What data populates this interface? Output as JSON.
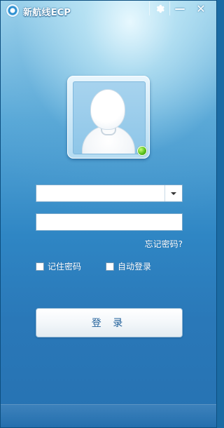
{
  "window": {
    "title": "新航线ECP",
    "controls": {
      "settings_icon": "gear-icon",
      "minimize_label": "—",
      "close_label": "✕"
    }
  },
  "avatar": {
    "status": "online",
    "status_color": "#59c11b"
  },
  "login_form": {
    "account": {
      "value": "",
      "placeholder": ""
    },
    "password": {
      "value": "",
      "placeholder": ""
    },
    "forgot_password_label": "忘记密码?",
    "remember_password_label": "记住密码",
    "remember_password_checked": false,
    "auto_login_label": "自动登录",
    "auto_login_checked": false,
    "login_button_label": "登 录"
  },
  "colors": {
    "background_top": "#a9daf0",
    "background_bottom": "#2672b2",
    "button_text": "#1f5f99"
  }
}
